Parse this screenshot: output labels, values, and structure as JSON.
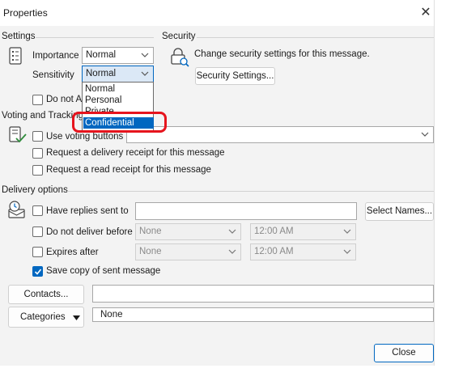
{
  "window": {
    "title": "Properties",
    "close_glyph": "✕"
  },
  "settings": {
    "section": "Settings",
    "importance": {
      "label": "Importance",
      "value": "Normal"
    },
    "sensitivity": {
      "label": "Sensitivity",
      "value": "Normal",
      "options": [
        "Normal",
        "Personal",
        "Private",
        "Confidential"
      ],
      "highlighted": "Confidential"
    },
    "do_not_autoarchive": {
      "label": "Do not Au",
      "checked": false
    }
  },
  "security": {
    "section": "Security",
    "description": "Change security settings for this message.",
    "button": "Security Settings..."
  },
  "voting": {
    "section": "Voting and Tracking",
    "use_voting_buttons": {
      "label": "Use voting buttons",
      "checked": false
    },
    "delivery_receipt": {
      "label": "Request a delivery receipt for this message",
      "checked": false
    },
    "read_receipt": {
      "label": "Request a read receipt for this message",
      "checked": false
    }
  },
  "delivery": {
    "section": "Delivery options",
    "replies_to": {
      "label": "Have replies sent to",
      "checked": false,
      "value": ""
    },
    "select_names_button": "Select Names...",
    "do_not_deliver": {
      "label": "Do not deliver before",
      "checked": false,
      "date": "None",
      "time": "12:00 AM"
    },
    "expires": {
      "label": "Expires after",
      "checked": false,
      "date": "None",
      "time": "12:00 AM"
    },
    "save_copy": {
      "label": "Save copy of sent message",
      "checked": true
    }
  },
  "contacts": {
    "button": "Contacts...",
    "value": ""
  },
  "categories": {
    "button": "Categories",
    "value": "None"
  },
  "footer": {
    "close_button": "Close"
  },
  "colors": {
    "accent": "#0067c0",
    "highlight_ring": "#e6141d",
    "dialog_bg": "#f3f3f3"
  },
  "icons": [
    "settings-list-icon",
    "security-lock-icon",
    "voting-check-icon",
    "delivery-clock-icon",
    "chevron-down-icon",
    "checkmark-icon"
  ]
}
